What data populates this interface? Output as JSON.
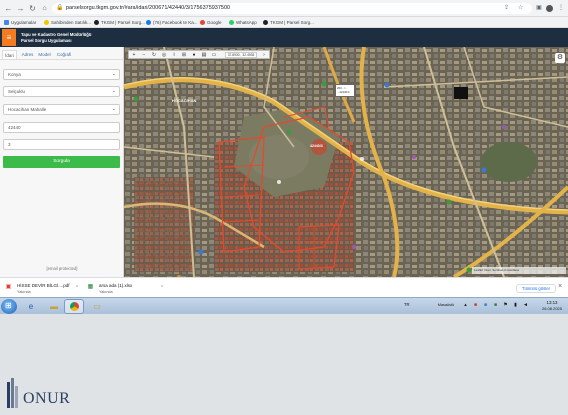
{
  "browser": {
    "url": "parselsorgu.tkgm.gov.tr/#ara/idari/200671/42440/3/1756375937500",
    "bookmarks": [
      {
        "label": "Uygulamalar",
        "color": "#4285f4"
      },
      {
        "label": "Sahibinden Satılık...",
        "color": "#f6c400"
      },
      {
        "label": "TKGM | Parsel Sorg...",
        "color": "#202124"
      },
      {
        "label": "(76) Facebook te Ka...",
        "color": "#1877f2"
      },
      {
        "label": "Google",
        "color": "#ea4335"
      },
      {
        "label": "WhatsApp",
        "color": "#25d366"
      },
      {
        "label": "TKGM | Parsel Sorg...",
        "color": "#202124"
      }
    ]
  },
  "app": {
    "header_line1": "Tapu ve Kadastro Genel Müdürlüğü",
    "header_line2": "Parsel Sorgu Uygulaması"
  },
  "sidebar": {
    "tabs": [
      {
        "label": "İdari",
        "active": true
      },
      {
        "label": "Adres",
        "active": false
      },
      {
        "label": "Model",
        "active": false
      },
      {
        "label": "Coğrafi",
        "active": false
      }
    ],
    "province": "Konya",
    "district": "Selçuklu",
    "neighborhood": "Hocacihan Mahalle",
    "block": "42440",
    "parcel": "3",
    "query_button": "Sorgula",
    "email": "[email protected]"
  },
  "map": {
    "coordinates": "37.8930 ; 32.4935",
    "attribution": "Leaflet | Esri, Sentinel-2 cloudless",
    "popup_line1": "200.../...",
    "popup_line2": "...42440/3",
    "parcel_label": "42440/3",
    "district_label": "HOCACİHAN"
  },
  "downloads": [
    {
      "name": "HİSSE DEVİR BİLGİ....pdf",
      "status": "Yakında",
      "icon": "pdf-icon",
      "color": "#e53935"
    },
    {
      "name": "arsa ada (1).xlsx",
      "status": "Yakında",
      "icon": "excel-icon",
      "color": "#1e7e34"
    }
  ],
  "downloads_show_all": "Tümünü göster",
  "taskbar": {
    "language": "TR",
    "desktop_label": "Masaüstü",
    "time": "13:13",
    "date": "26.08.2025"
  },
  "logo_text": "ONUR",
  "colors": {
    "header_bg": "#1c2e40",
    "accent_orange": "#f47b20",
    "query_green": "#3dbb4a",
    "parcel_outline": "#e24a2c"
  }
}
